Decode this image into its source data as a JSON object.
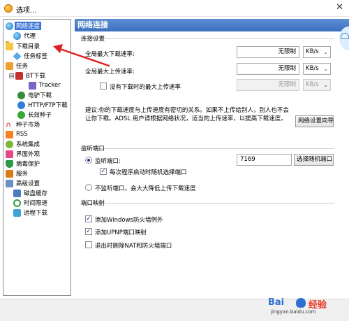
{
  "window": {
    "title": "选项...",
    "close_glyph": "✕",
    "app_icon": "orange-ball-icon"
  },
  "tree": {
    "items": [
      {
        "label": "网络连接",
        "icon": "globe-icon",
        "expander": "⊟",
        "selected": true
      },
      {
        "label": "代理",
        "icon": "globe-icon"
      },
      {
        "label": "下载目录",
        "icon": "folder-icon"
      },
      {
        "label": "任务标签",
        "icon": "tag-icon"
      },
      {
        "label": "任务",
        "icon": "task-icon",
        "expander": "⊟"
      },
      {
        "label": "BT下载",
        "icon": "bt-icon",
        "expander": "⊟"
      },
      {
        "label": "Tracker",
        "icon": "cube-icon"
      },
      {
        "label": "电驴下载",
        "icon": "emule-icon"
      },
      {
        "label": "HTTP/FTP下载",
        "icon": "http-icon"
      },
      {
        "label": "长效种子",
        "icon": "seed-icon"
      },
      {
        "label": "种子市场",
        "icon": "magnet-icon"
      },
      {
        "label": "RSS",
        "icon": "rss-icon"
      },
      {
        "label": "系统集成",
        "icon": "system-icon"
      },
      {
        "label": "界面外观",
        "icon": "appearance-icon"
      },
      {
        "label": "病毒保护",
        "icon": "shield-icon"
      },
      {
        "label": "服务",
        "icon": "service-icon"
      },
      {
        "label": "高级设置",
        "icon": "advanced-icon",
        "expander": "⊟"
      },
      {
        "label": "磁盘缓存",
        "icon": "disk-icon"
      },
      {
        "label": "时间限速",
        "icon": "clock-icon"
      },
      {
        "label": "远程下载",
        "icon": "remote-icon"
      }
    ]
  },
  "panel": {
    "header": "网络连接",
    "connection": {
      "title": "连接设置",
      "max_down_label": "全局最大下载速率:",
      "max_down_value": "无限制",
      "max_down_unit": "KB/s",
      "max_up_label": "全局最大上传速率:",
      "max_up_value": "无限制",
      "max_up_unit": "KB/s",
      "no_task_label": "没有下载时的最大上传速率",
      "no_task_value": "无限制",
      "no_task_unit": "KB/s",
      "advice_line1": "建议:你的下载速度与上传速度有密切的关系。如果不上传给别人，别人也不会",
      "advice_line2": "让你下载。ADSL 用户请根据网络状况，适当的上传速率，以提高下载速度。",
      "wizard_button": "网络设置向导"
    },
    "listen": {
      "title": "监听端口",
      "listen_label": "监听端口:",
      "port_value": "7169",
      "random_button": "选择随机端口",
      "random_on_start_label": "每次程序启动时随机选择端口",
      "no_listen_label": "不监听端口，会大大降低上传下载速度"
    },
    "mapping": {
      "title": "端口映射",
      "firewall_label": "添加Windows防火墙例外",
      "upnp_label": "添加UPNP端口映射",
      "remove_label": "退出时删除NAT和防火墙端口"
    }
  },
  "watermark": {
    "left": "Bai",
    "right": "经验",
    "url": "jingyan.baidu.com"
  },
  "colors": {
    "header_bg": "#3b6fc0",
    "selection": "#3b73d6",
    "arrow": "#e02020"
  }
}
